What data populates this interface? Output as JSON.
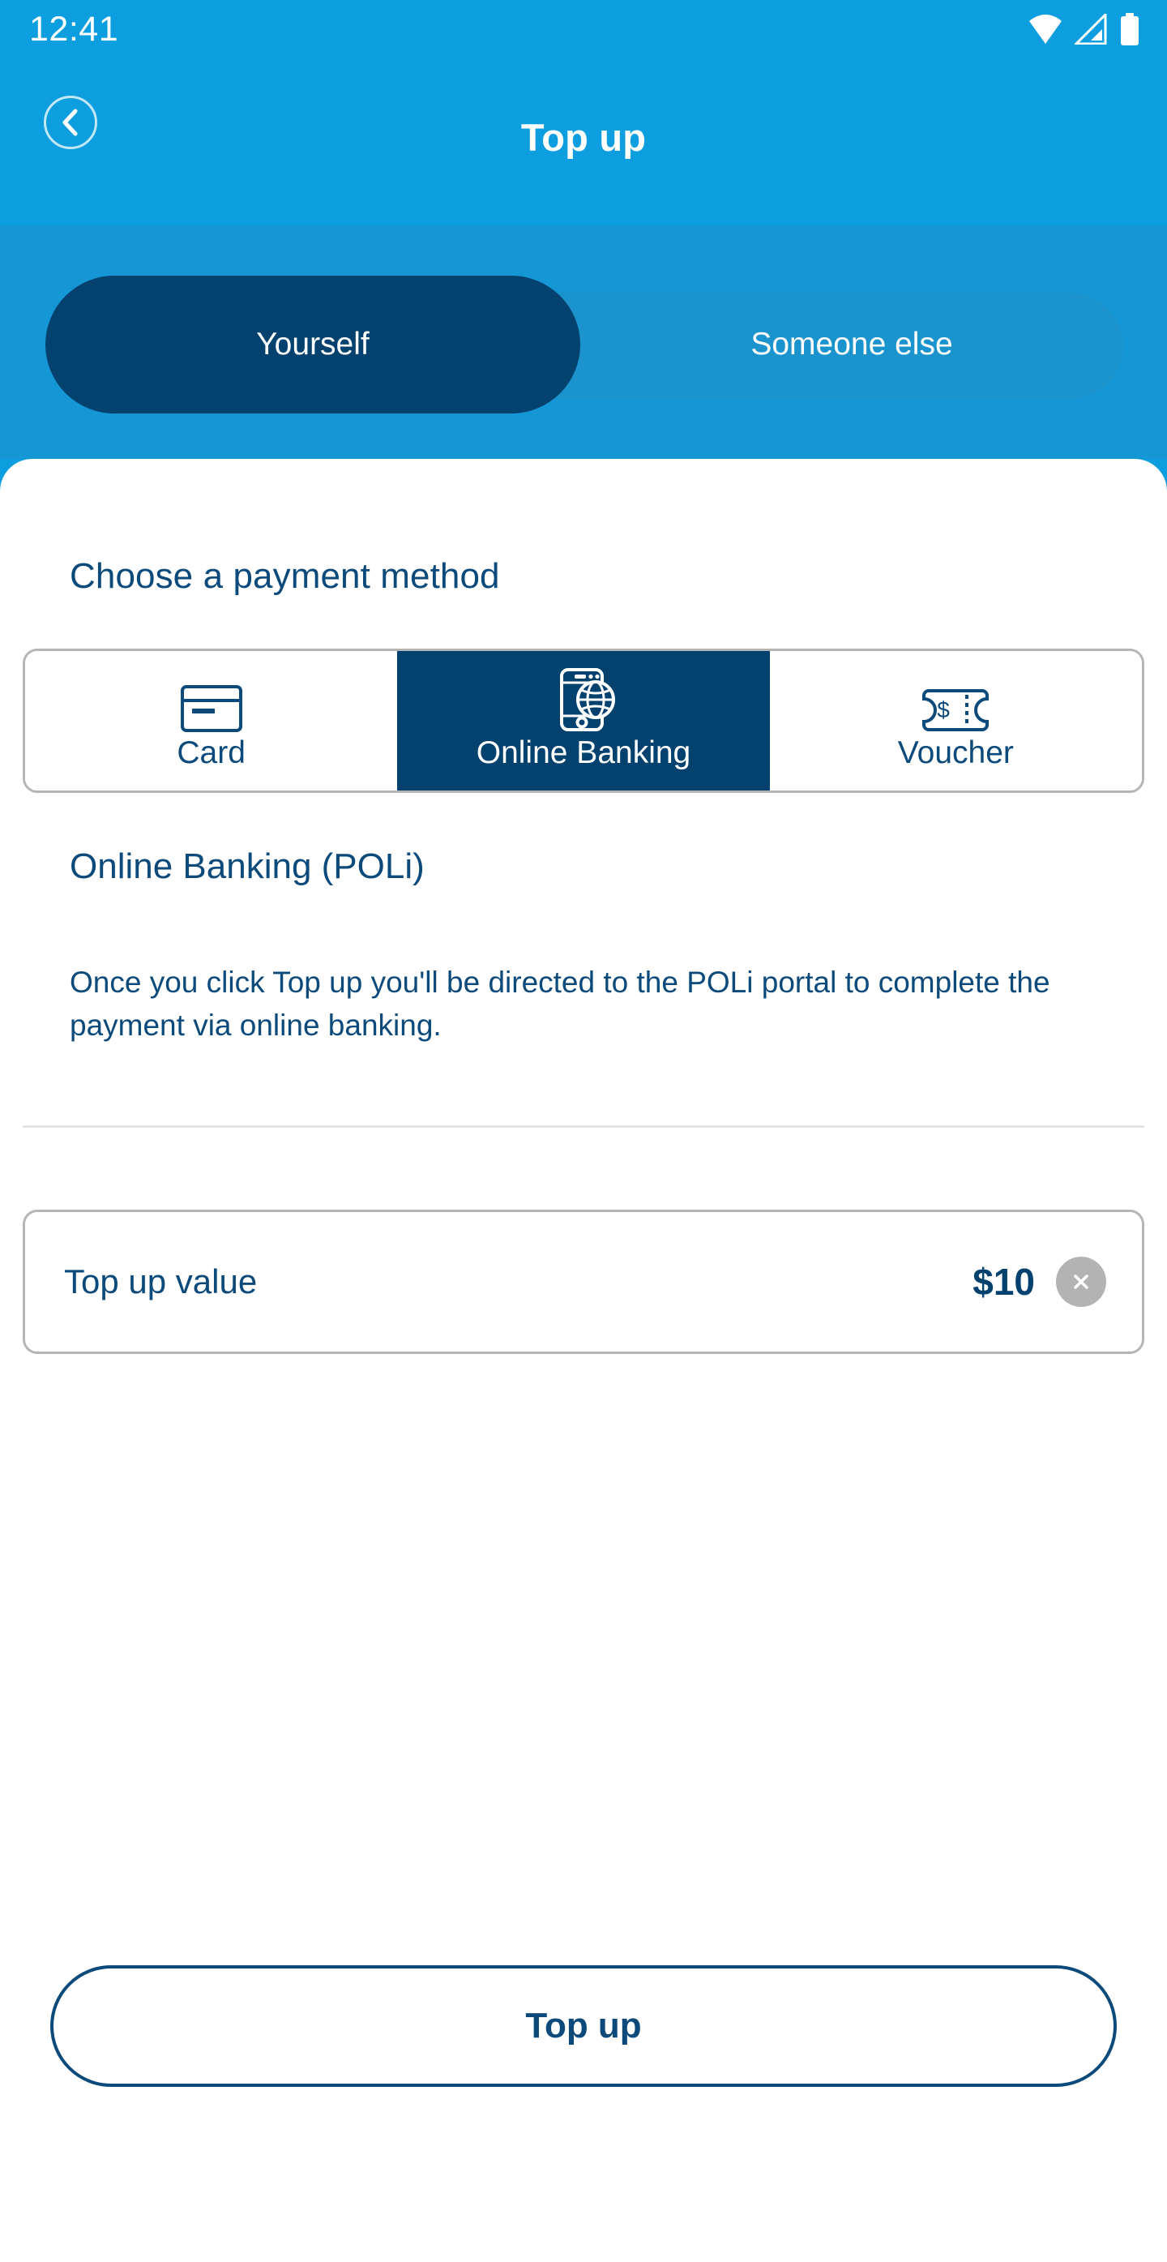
{
  "status_bar": {
    "time": "12:41",
    "icons": [
      "wifi-icon",
      "cellular-signal-icon",
      "battery-icon"
    ]
  },
  "app_bar": {
    "title": "Top up",
    "back_icon": "chevron-left-icon"
  },
  "audience_toggle": {
    "options": [
      {
        "label": "Yourself",
        "selected": true
      },
      {
        "label": "Someone else",
        "selected": false
      }
    ]
  },
  "payment": {
    "section_title": "Choose a payment method",
    "methods": [
      {
        "label": "Card",
        "icon": "credit-card-icon",
        "selected": false
      },
      {
        "label": "Online Banking",
        "icon": "mobile-globe-icon",
        "selected": true
      },
      {
        "label": "Voucher",
        "icon": "voucher-ticket-icon",
        "selected": false
      }
    ],
    "detail_heading": "Online Banking (POLi)",
    "detail_description": "Once you click Top up you'll be directed to the POLi portal to complete the payment via online banking."
  },
  "topup_value": {
    "label": "Top up value",
    "amount": "$10",
    "clear_icon": "close-x-icon"
  },
  "primary_action": {
    "label": "Top up"
  },
  "colors": {
    "header_blue": "#0d9ee0",
    "band_blue": "#1597d6",
    "navy": "#03426e",
    "text_navy": "#0b4a7a",
    "border_gray": "#b5b5b5",
    "divider_gray": "#e6e6e6",
    "clear_button_gray": "#b3b3b3"
  }
}
